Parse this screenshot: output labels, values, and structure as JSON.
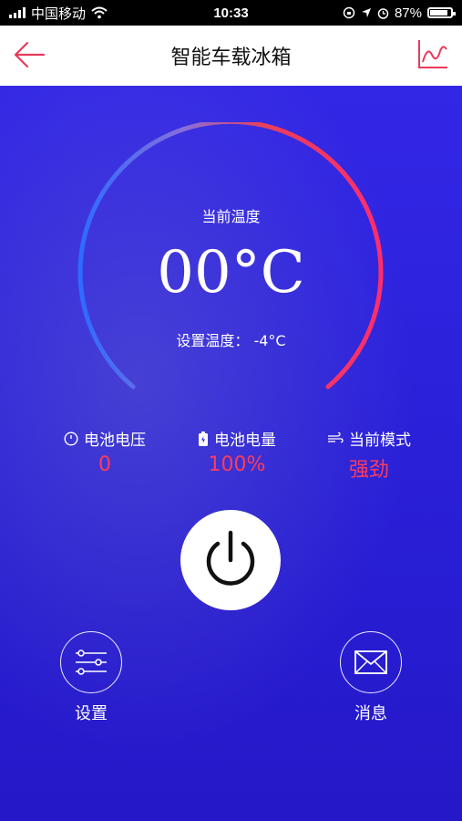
{
  "status_bar": {
    "carrier": "中国移动",
    "time": "10:33",
    "battery_percent": "87%"
  },
  "nav": {
    "title": "智能车载冰箱",
    "back_icon": "arrow-left-icon",
    "chart_icon": "line-chart-icon",
    "accent_color": "#e83a5a"
  },
  "gauge": {
    "label": "当前温度",
    "value": "00°C",
    "set_temp": "设置温度： -4°C",
    "gradient_start": "#2d6bff",
    "gradient_end": "#ff2d55"
  },
  "stats": [
    {
      "icon": "clock-icon",
      "label": "电池电压",
      "value": "0"
    },
    {
      "icon": "battery-icon",
      "label": "电池电量",
      "value": "100%"
    },
    {
      "icon": "wind-icon",
      "label": "当前模式",
      "value": "强劲"
    }
  ],
  "power_button": {
    "icon": "power-icon"
  },
  "bottom": {
    "settings_label": "设置",
    "settings_icon": "sliders-icon",
    "message_label": "消息",
    "message_icon": "mail-icon"
  }
}
